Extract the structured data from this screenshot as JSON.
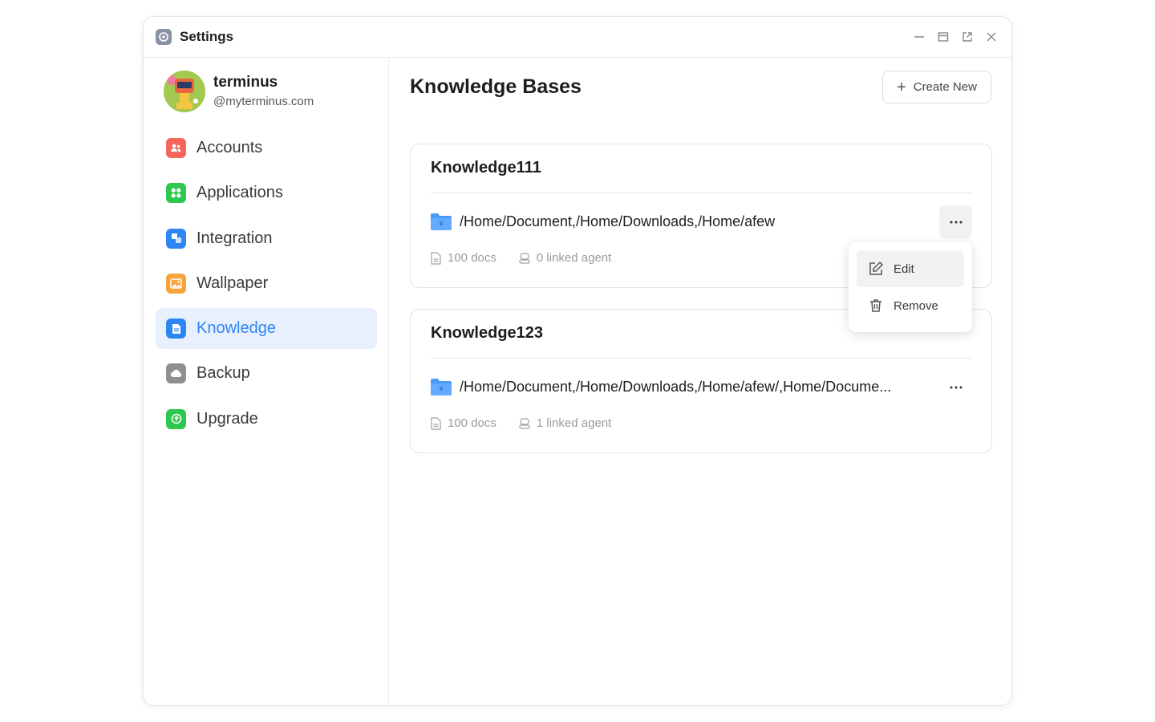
{
  "window": {
    "title": "Settings",
    "controls": [
      "minimize-icon",
      "maximize-icon",
      "popout-icon",
      "close-icon"
    ]
  },
  "profile": {
    "name": "terminus",
    "domain": "@myterminus.com"
  },
  "sidebar": {
    "items": [
      {
        "label": "Accounts",
        "icon": "accounts-icon",
        "color": "#f2675a",
        "active": false
      },
      {
        "label": "Applications",
        "icon": "applications-icon",
        "color": "#2fc84e",
        "active": false
      },
      {
        "label": "Integration",
        "icon": "integration-icon",
        "color": "#2e86f5",
        "active": false
      },
      {
        "label": "Wallpaper",
        "icon": "wallpaper-icon",
        "color": "#f7a43b",
        "active": false
      },
      {
        "label": "Knowledge",
        "icon": "knowledge-icon",
        "color": "#2e86f5",
        "active": true
      },
      {
        "label": "Backup",
        "icon": "backup-icon",
        "color": "#8e8e93",
        "active": false
      },
      {
        "label": "Upgrade",
        "icon": "upgrade-icon",
        "color": "#2fc84e",
        "active": false
      }
    ]
  },
  "main": {
    "title": "Knowledge Bases",
    "create_label": "Create New",
    "cards": [
      {
        "name": "Knowledge111",
        "path": "/Home/Document,/Home/Downloads,/Home/afew",
        "docs": "100 docs",
        "agents": "0 linked agent"
      },
      {
        "name": "Knowledge123",
        "path": "/Home/Document,/Home/Downloads,/Home/afew/,Home/Docume...",
        "docs": "100 docs",
        "agents": "1 linked agent"
      }
    ]
  },
  "menu": {
    "edit_label": "Edit",
    "remove_label": "Remove"
  },
  "colors": {
    "accent": "#2e86f5",
    "active_bg": "#e8f0fe"
  }
}
